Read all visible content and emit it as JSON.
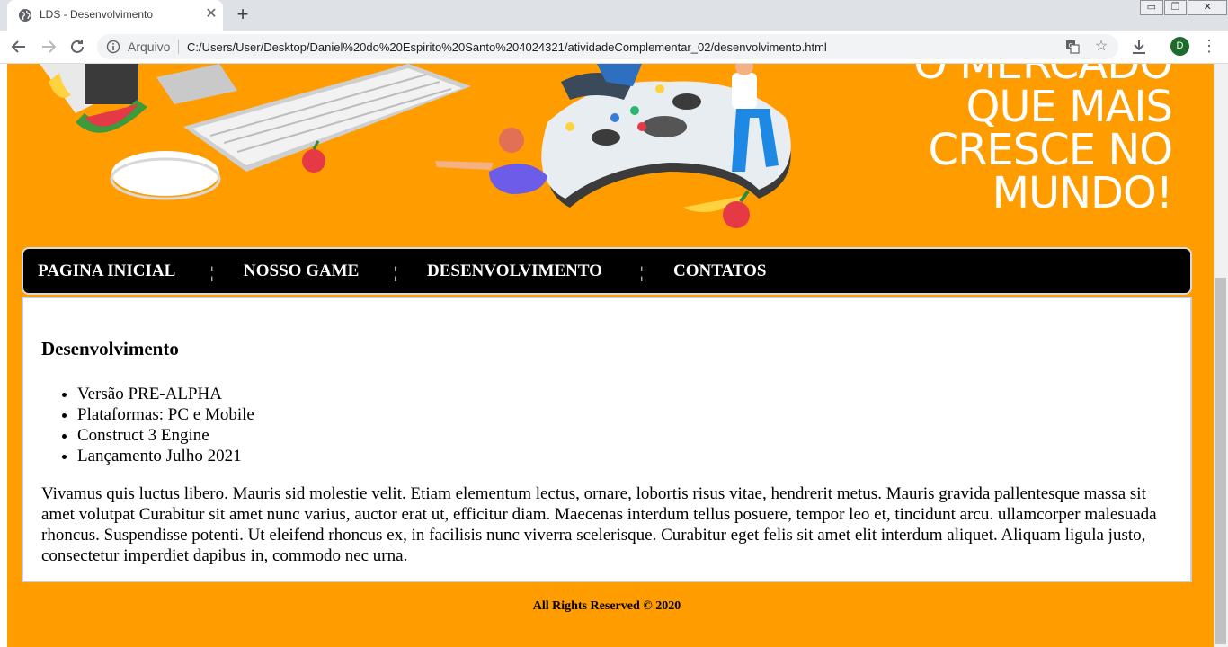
{
  "browser": {
    "tab_title": "LDS - Desenvolvimento",
    "tab_close": "✕",
    "new_tab": "+",
    "scheme_label": "Arquivo",
    "url": "C:/Users/User/Desktop/Daniel%20do%20Espirito%20Santo%204024321/atividadeComplementar_02/desenvolvimento.html",
    "profile_initial": "D",
    "window_controls": {
      "minimize": "▭",
      "restore": "❐",
      "close": "✕"
    }
  },
  "banner": {
    "headline_lines": [
      "O MERCADO",
      "QUE MAIS",
      "CRESCE NO",
      "MUNDO!"
    ],
    "background": "#ff9c00"
  },
  "nav": {
    "items": [
      "PAGINA INICIAL",
      "NOSSO GAME",
      "DESENVOLVIMENTO",
      "CONTATOS"
    ],
    "separator": "¦"
  },
  "content": {
    "title": "Desenvolvimento",
    "features": [
      "Versão PRE-ALPHA",
      "Plataformas: PC e Mobile",
      "Construct 3 Engine",
      "Lançamento Julho 2021"
    ],
    "paragraph": "Vivamus quis luctus libero. Mauris sid molestie velit. Etiam elementum lectus, ornare, lobortis risus vitae, hendrerit metus. Mauris gravida pallentesque massa sit amet volutpat Curabitur sit amet nunc varius, auctor erat ut, efficitur diam. Maecenas interdum tellus posuere, tempor leo et, tincidunt arcu. ullamcorper malesuada rhoncus. Suspendisse potenti. Ut eleifend rhoncus ex, in facilisis nunc viverra scelerisque. Curabitur eget felis sit amet elit interdum aliquet. Aliquam ligula justo, consectetur imperdiet dapibus in, commodo nec urna."
  },
  "footer": {
    "text": "All Rights Reserved © 2020"
  },
  "colors": {
    "page_bg": "#ff9c00",
    "nav_bg": "#000000",
    "content_bg": "#ffffff"
  }
}
